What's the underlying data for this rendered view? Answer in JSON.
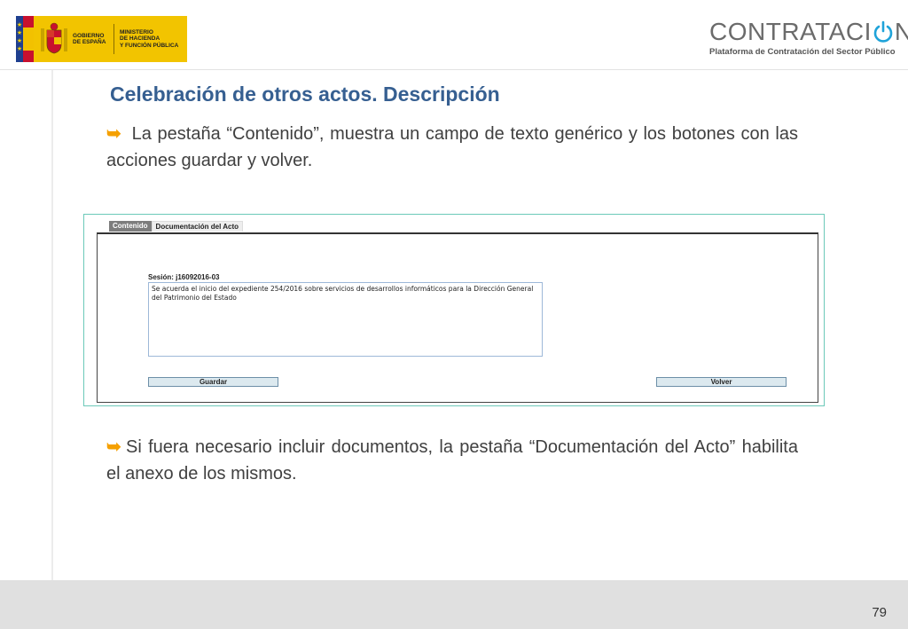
{
  "header": {
    "gov_logo": {
      "left_text": "GOBIERNO\nDE ESPAÑA",
      "right_text": "MINISTERIO\nDE HACIENDA\nY FUNCIÓN PÚBLICA"
    },
    "brand": {
      "word_prefix": "CONTRATACI",
      "word_suffix": "N",
      "subtitle": "Plataforma de Contratación del Sector Público",
      "accent": "#1fa3d9"
    }
  },
  "slide": {
    "title": "Celebración de otros actos. Descripción",
    "paragraph_1": " La pestaña “Contenido”, muestra un campo de texto genérico y los botones con las acciones guardar y volver.",
    "paragraph_2": "Si fuera necesario incluir documentos, la pestaña “Documentación del Acto” habilita el anexo de los mismos.",
    "bullet_icon": "orange-curved-arrow-icon",
    "page_number": "79"
  },
  "screenshot": {
    "tabs": [
      {
        "label": "Contenido",
        "active": true
      },
      {
        "label": "Documentación del Acto",
        "active": false
      }
    ],
    "session_label": "Sesión: j16092016-03",
    "textarea_value": "Se acuerda el inicio del expediente 254/2016 sobre servicios de desarrollos informáticos para la Dirección General del Patrimonio del Estado",
    "save_label": "Guardar",
    "back_label": "Volver"
  }
}
